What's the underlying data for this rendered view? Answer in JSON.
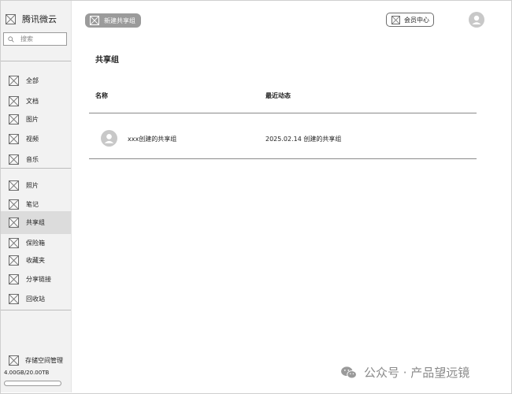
{
  "app": {
    "title": "腾讯微云"
  },
  "search": {
    "placeholder": "搜索"
  },
  "sidebar": {
    "group1": [
      {
        "label": "全部"
      },
      {
        "label": "文档"
      },
      {
        "label": "图片"
      },
      {
        "label": "视频"
      },
      {
        "label": "音乐"
      }
    ],
    "group2": [
      {
        "label": "照片"
      },
      {
        "label": "笔记"
      },
      {
        "label": "共享组",
        "active": true
      },
      {
        "label": "保险箱"
      },
      {
        "label": "收藏夹"
      },
      {
        "label": "分享链接"
      },
      {
        "label": "回收站"
      }
    ],
    "storage": {
      "label": "存储空间管理",
      "amount": "4.00GB/20.00TB",
      "used_fraction": 0.0002
    }
  },
  "header": {
    "new_group_label": "新建共享组",
    "vip_label": "会员中心"
  },
  "main": {
    "title": "共享组",
    "columns": {
      "name": "名称",
      "activity": "最近动态"
    },
    "rows": [
      {
        "name": "xxx创建的共享组",
        "activity": "2025.02.14 创建的共享组"
      }
    ]
  },
  "watermark": {
    "text": "公众号 · 产品望远镜"
  }
}
